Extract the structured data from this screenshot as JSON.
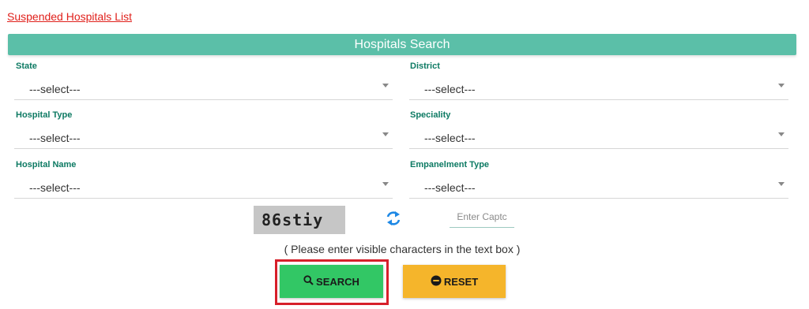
{
  "top_link": "Suspended Hospitals List",
  "header_title": "Hospitals Search",
  "fields": {
    "state": {
      "label": "State",
      "value": "---select---"
    },
    "district": {
      "label": "District",
      "value": "---select---"
    },
    "hospital_type": {
      "label": "Hospital Type",
      "value": "---select---"
    },
    "speciality": {
      "label": "Speciality",
      "value": "---select---"
    },
    "hospital_name": {
      "label": "Hospital Name",
      "value": "---select---"
    },
    "empanelment_type": {
      "label": "Empanelment Type",
      "value": "---select---"
    }
  },
  "captcha": {
    "code": "86stiy",
    "placeholder": "Enter Captc",
    "hint": "( Please enter visible characters in the text box )"
  },
  "buttons": {
    "search": "SEARCH",
    "reset": "RESET"
  },
  "colors": {
    "header_bg": "#5bbfa8",
    "label": "#0d7a63",
    "link": "#e0201b",
    "search_btn": "#32c765",
    "reset_btn": "#f5b52b",
    "highlight": "#d71f2a",
    "refresh_icon": "#1e88e5"
  },
  "icons": {
    "refresh": "refresh-icon",
    "search": "search-icon",
    "reset": "minus-circle-icon",
    "caret": "chevron-down-icon"
  }
}
